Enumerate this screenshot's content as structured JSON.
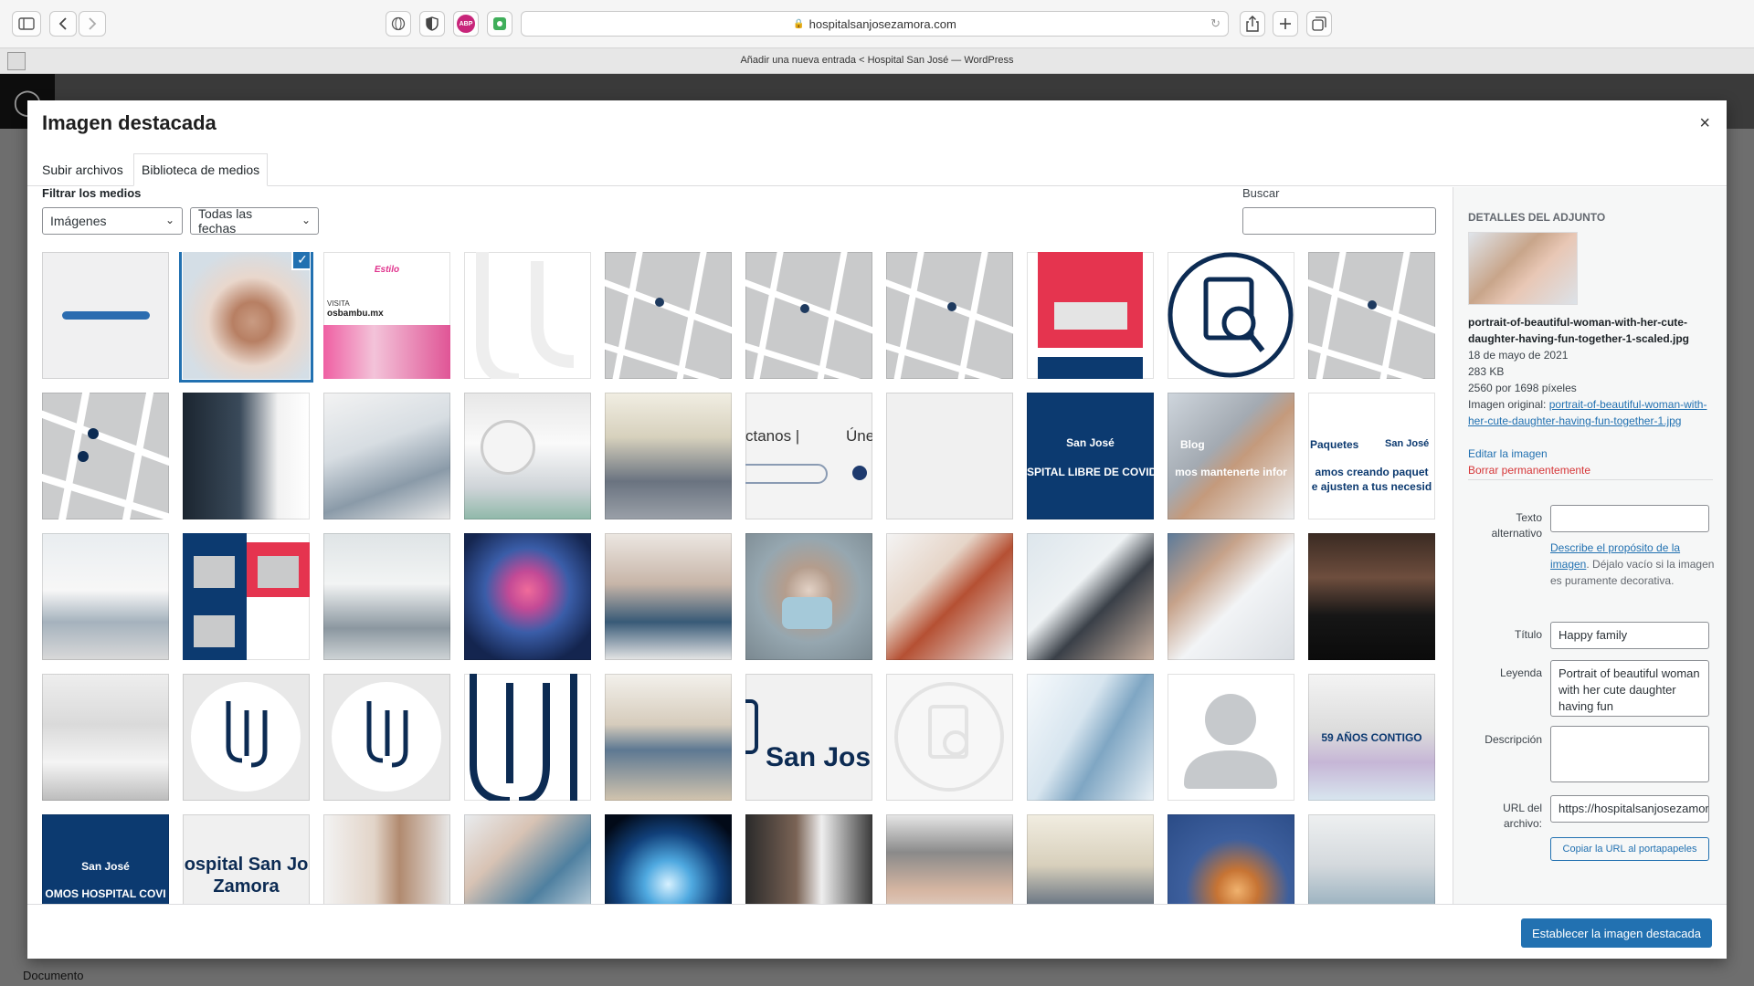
{
  "browser": {
    "url": "hospitalsanjosezamora.com",
    "tab_title": "Añadir una nueva entrada < Hospital San José — WordPress",
    "extensions": [
      "globe-icon",
      "shield-icon",
      "adblock-icon",
      "extension-icon"
    ],
    "adblock_label": "ABP"
  },
  "modal": {
    "title": "Imagen destacada",
    "close_label": "×",
    "tabs": [
      "Subir archivos",
      "Biblioteca de medios"
    ],
    "filter_label": "Filtrar los medios",
    "filter_type": "Imágenes",
    "filter_date": "Todas las fechas",
    "search_label": "Buscar",
    "set_button": "Establecer la imagen destacada"
  },
  "grid": {
    "thumb_texts": {
      "estilo": "Estilo",
      "visita": "VISITA",
      "osbambu": "osbambu.mx",
      "tanos": "ctanos |",
      "une": "Úne",
      "sanjose": "San José",
      "libre": "SPITAL LIBRE DE COVID",
      "blog": "Blog",
      "mantenerte": "mos mantenerte infor",
      "paquetes": "Paquetes",
      "creando": "amos creando paquet",
      "ajusten": "e ajusten a tus necesid",
      "sanjos": "San Jos",
      "anios": "59 AÑOS CONTIGO",
      "somos": "OMOS HOSPITAL COVI",
      "hospital1": "ospital San Jo",
      "hospital2": "Zamora"
    }
  },
  "details": {
    "heading": "Detalles del adjunto",
    "filename": "portrait-of-beautiful-woman-with-her-cute-daughter-having-fun-together-1-scaled.jpg",
    "date": "18 de mayo de 2021",
    "size": "283 KB",
    "dimensions": "2560 por 1698 píxeles",
    "original_label": "Imagen original:",
    "original_link": "portrait-of-beautiful-woman-with-her-cute-daughter-having-fun-together-1.jpg",
    "edit_link": "Editar la imagen",
    "delete_link": "Borrar permanentemente",
    "alt_label": "Texto alternativo",
    "alt_value": "",
    "alt_help_link": "Describe el propósito de la imagen",
    "alt_help_rest": ". Déjalo vacío si la imagen es puramente decorativa.",
    "title_label": "Título",
    "title_value": "Happy family",
    "caption_label": "Leyenda",
    "caption_value": "Portrait of beautiful woman with her cute daughter having fun",
    "description_label": "Descripción",
    "description_value": "",
    "url_label": "URL del archivo:",
    "url_value": "https://hospitalsanjosezamora",
    "copy_button": "Copiar la URL al portapapeles"
  },
  "background": {
    "status": "Documento"
  }
}
